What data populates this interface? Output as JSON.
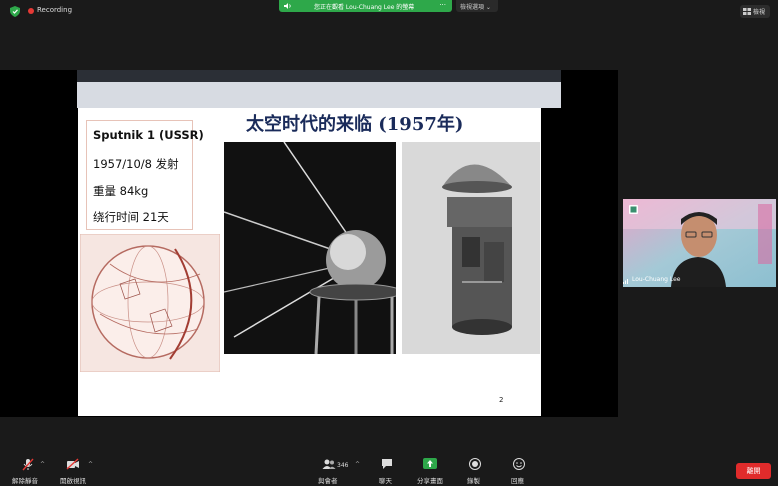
{
  "top_bar": {
    "recording_label": "Recording",
    "share_banner_text": "您正在觀看 Lou-Chuang Lee 的螢幕",
    "share_banner_menu": "···",
    "view_options_label": "檢視選項 ⌄",
    "view_button_label": "檢視"
  },
  "slide": {
    "title": "太空时代的来临 (1957年)",
    "info": {
      "line1": "Sputnik 1 (USSR)",
      "line2": "1957/10/8 发射",
      "line3": "重量 84kg",
      "line4": "绕行时间 21天"
    },
    "page_number": "2"
  },
  "participant": {
    "name": "Lou-Chuang Lee"
  },
  "toolbar": {
    "mute_label": "解除靜音",
    "video_label": "開啟視訊",
    "participants_label": "與會者",
    "participants_count": "346",
    "chat_label": "聊天",
    "share_label": "分享畫面",
    "record_label": "錄製",
    "reactions_label": "回應",
    "end_label": "離開",
    "caret": "^",
    "colors": {
      "share_green": "#2ea84a",
      "end_red": "#e02b2b"
    }
  }
}
